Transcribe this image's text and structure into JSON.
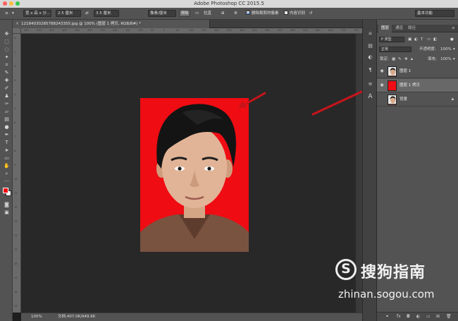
{
  "titlebar": {
    "title": "Adobe Photoshop CC 2015.5"
  },
  "options": {
    "ratio": "宽 x 高 x 分...",
    "width": "2.5 厘米",
    "height": "3.5 厘米",
    "units": "像素/厘米",
    "clear": "清除",
    "straighten": "拉直",
    "delete_cropped_label": "删除裁剪的像素",
    "content_aware_label": "内容识别",
    "workspace": "基本功能"
  },
  "document": {
    "tab_title": "12184030285788243355.jpg @ 100% (图层 1 拷贝, RGB/8#) *"
  },
  "ruler_h": [
    "550",
    "500",
    "450",
    "400",
    "350",
    "300",
    "250",
    "200",
    "150",
    "100",
    "50",
    "0",
    "50",
    "100",
    "150",
    "200",
    "250",
    "300",
    "350",
    "400",
    "450",
    "500",
    "550",
    "600",
    "650",
    "700",
    "750"
  ],
  "ruler_v": [
    "0",
    "1",
    "2",
    "3",
    "4",
    "5",
    "6",
    "7",
    "8",
    "9",
    "10",
    "11",
    "12",
    "13",
    "14",
    "15",
    "16",
    "17",
    "18",
    "19"
  ],
  "status": {
    "zoom": "100%",
    "doc_info": "文档:407.0K/949.6K"
  },
  "panel": {
    "tabs": [
      "图层",
      "通道",
      "路径"
    ],
    "filter_kind": "P 类型",
    "blend_mode": "正常",
    "opacity_label": "不透明度:",
    "opacity_value": "100%",
    "lock_label": "锁定:",
    "fill_label": "填充:",
    "fill_value": "100%",
    "layers": [
      {
        "name": "图层 1",
        "thumb": "face"
      },
      {
        "name": "图层 1 拷贝",
        "thumb": "red"
      },
      {
        "name": "背景",
        "thumb": "face"
      }
    ]
  },
  "colors": {
    "foreground": "#ef0c13",
    "background": "#ffffff",
    "photo_bg": "#ef0c13",
    "arrow": "#c8141b"
  },
  "watermark": {
    "logo_letter": "S",
    "brand_cn": "搜狗指南",
    "url": "zhinan.sogou.com"
  }
}
